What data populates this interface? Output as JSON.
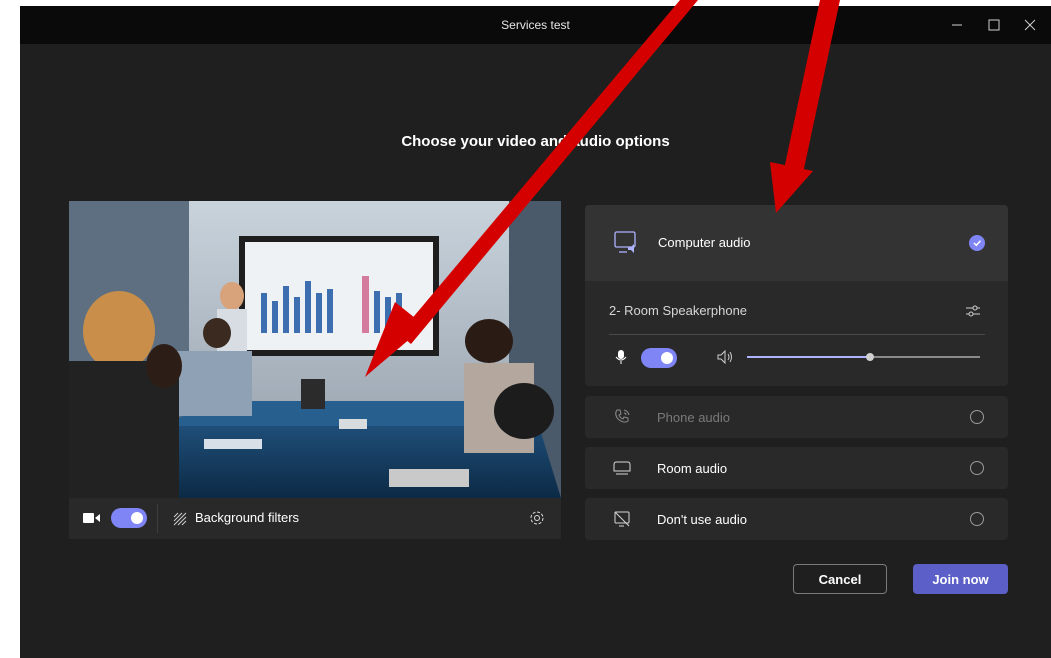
{
  "window": {
    "title": "Services test"
  },
  "heading": "Choose your video and audio options",
  "video": {
    "background_filters_label": "Background filters",
    "camera_on": true
  },
  "audio": {
    "computer_audio": {
      "label": "Computer audio",
      "selected": true
    },
    "device": {
      "name": "2- Room Speakerphone"
    },
    "mic_on": true,
    "volume": 0.53,
    "options": [
      {
        "label": "Phone audio",
        "disabled": true
      },
      {
        "label": "Room audio",
        "disabled": false
      },
      {
        "label": "Don't use audio",
        "disabled": false
      }
    ]
  },
  "actions": {
    "cancel_label": "Cancel",
    "join_label": "Join now"
  },
  "colors": {
    "accent": "#7f85f5",
    "annotation_arrow": "#d40000"
  }
}
